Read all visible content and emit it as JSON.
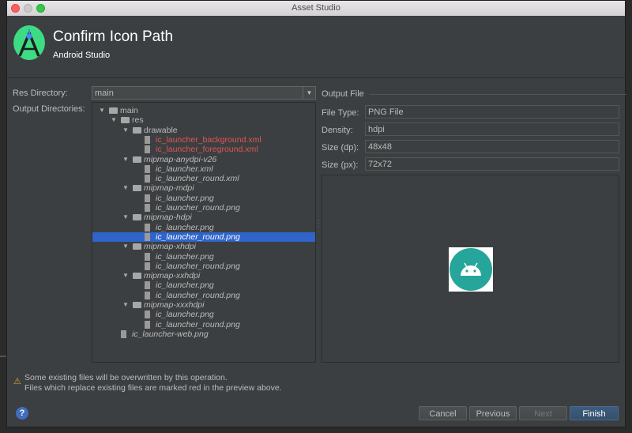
{
  "window": {
    "title": "Asset Studio"
  },
  "header": {
    "title": "Confirm Icon Path",
    "subtitle": "Android Studio"
  },
  "form": {
    "res_directory_label": "Res Directory:",
    "res_directory_value": "main",
    "output_directories_label": "Output Directories:"
  },
  "tree": {
    "items": [
      {
        "label": "main",
        "type": "folder",
        "depth": 0,
        "expanded": true
      },
      {
        "label": "res",
        "type": "folder",
        "depth": 1,
        "expanded": true
      },
      {
        "label": "drawable",
        "type": "folder",
        "depth": 2,
        "expanded": true
      },
      {
        "label": "ic_launcher_background.xml",
        "type": "file",
        "depth": 3,
        "red": true
      },
      {
        "label": "ic_launcher_foreground.xml",
        "type": "file",
        "depth": 3,
        "red": true
      },
      {
        "label": "mipmap-anydpi-v26",
        "type": "folder",
        "depth": 2,
        "expanded": true,
        "italic": true
      },
      {
        "label": "ic_launcher.xml",
        "type": "file",
        "depth": 3,
        "italic": true
      },
      {
        "label": "ic_launcher_round.xml",
        "type": "file",
        "depth": 3,
        "italic": true
      },
      {
        "label": "mipmap-mdpi",
        "type": "folder",
        "depth": 2,
        "expanded": true,
        "italic": true
      },
      {
        "label": "ic_launcher.png",
        "type": "file",
        "depth": 3,
        "italic": true
      },
      {
        "label": "ic_launcher_round.png",
        "type": "file",
        "depth": 3,
        "italic": true
      },
      {
        "label": "mipmap-hdpi",
        "type": "folder",
        "depth": 2,
        "expanded": true,
        "italic": true
      },
      {
        "label": "ic_launcher.png",
        "type": "file",
        "depth": 3,
        "italic": true
      },
      {
        "label": "ic_launcher_round.png",
        "type": "file",
        "depth": 3,
        "italic": true,
        "selected": true
      },
      {
        "label": "mipmap-xhdpi",
        "type": "folder",
        "depth": 2,
        "expanded": true,
        "italic": true
      },
      {
        "label": "ic_launcher.png",
        "type": "file",
        "depth": 3,
        "italic": true
      },
      {
        "label": "ic_launcher_round.png",
        "type": "file",
        "depth": 3,
        "italic": true
      },
      {
        "label": "mipmap-xxhdpi",
        "type": "folder",
        "depth": 2,
        "expanded": true,
        "italic": true
      },
      {
        "label": "ic_launcher.png",
        "type": "file",
        "depth": 3,
        "italic": true
      },
      {
        "label": "ic_launcher_round.png",
        "type": "file",
        "depth": 3,
        "italic": true
      },
      {
        "label": "mipmap-xxxhdpi",
        "type": "folder",
        "depth": 2,
        "expanded": true,
        "italic": true
      },
      {
        "label": "ic_launcher.png",
        "type": "file",
        "depth": 3,
        "italic": true
      },
      {
        "label": "ic_launcher_round.png",
        "type": "file",
        "depth": 3,
        "italic": true
      },
      {
        "label": "ic_launcher-web.png",
        "type": "file",
        "depth": 1,
        "italic": true
      }
    ]
  },
  "output_file": {
    "heading": "Output File",
    "file_type_label": "File Type:",
    "file_type_value": "PNG File",
    "density_label": "Density:",
    "density_value": "hdpi",
    "size_dp_label": "Size (dp):",
    "size_dp_value": "48x48",
    "size_px_label": "Size (px):",
    "size_px_value": "72x72"
  },
  "warning": {
    "line1": "Some existing files will be overwritten by this operation.",
    "line2": "Files which replace existing files are marked red in the preview above."
  },
  "buttons": {
    "help": "?",
    "cancel": "Cancel",
    "previous": "Previous",
    "next": "Next",
    "finish": "Finish"
  },
  "colors": {
    "accent": "#2f65ca",
    "overwrite": "#e05555",
    "icon_bg": "#26a69a"
  }
}
